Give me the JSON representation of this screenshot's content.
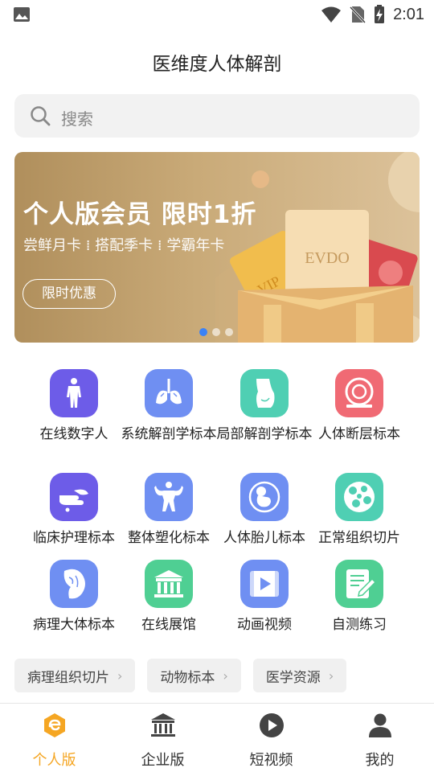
{
  "status_bar": {
    "time": "2:01"
  },
  "app_title": "医维度人体解剖",
  "search": {
    "placeholder": "搜索"
  },
  "banner": {
    "title": "个人版会员 限时1折",
    "subtitle": "尝鲜月卡 ⁞ 搭配季卡 ⁞ 学霸年卡",
    "button": "限时优惠",
    "card_text_1": "EVDO",
    "card_text_2": "VIP",
    "active_slide": 1,
    "slide_count": 3
  },
  "grid": [
    {
      "label": "在线数字人",
      "icon": "human-body-icon",
      "color": "#6d5ce8"
    },
    {
      "label": "系统解剖学标本",
      "icon": "lungs-icon",
      "color": "#6f8ff2"
    },
    {
      "label": "局部解剖学标本",
      "icon": "torso-icon",
      "color": "#4fcfb3"
    },
    {
      "label": "人体断层标本",
      "icon": "ct-scanner-icon",
      "color": "#f06a74"
    },
    {
      "label": "临床护理标本",
      "icon": "hand-icon",
      "color": "#6d5ce8"
    },
    {
      "label": "整体塑化标本",
      "icon": "muscle-figure-icon",
      "color": "#6f8ff2"
    },
    {
      "label": "人体胎儿标本",
      "icon": "fetus-icon",
      "color": "#6f8ff2"
    },
    {
      "label": "正常组织切片",
      "icon": "tissue-cells-icon",
      "color": "#4fcfb3"
    },
    {
      "label": "病理大体标本",
      "icon": "pathology-organ-icon",
      "color": "#6f8ff2"
    },
    {
      "label": "在线展馆",
      "icon": "museum-icon",
      "color": "#4fcf93"
    },
    {
      "label": "动画视频",
      "icon": "video-icon",
      "color": "#6f8ff2"
    },
    {
      "label": "自测练习",
      "icon": "quiz-icon",
      "color": "#4fcf93"
    }
  ],
  "tags": [
    {
      "label": "病理组织切片"
    },
    {
      "label": "动物标本"
    },
    {
      "label": "医学资源"
    }
  ],
  "bottom_nav": [
    {
      "label": "个人版",
      "icon": "personal-icon",
      "active": true
    },
    {
      "label": "企业版",
      "icon": "bank-icon",
      "active": false
    },
    {
      "label": "短视频",
      "icon": "play-icon",
      "active": false
    },
    {
      "label": "我的",
      "icon": "user-icon",
      "active": false
    }
  ],
  "colors": {
    "accent": "#f5a623",
    "dot_active": "#3b82f6"
  }
}
